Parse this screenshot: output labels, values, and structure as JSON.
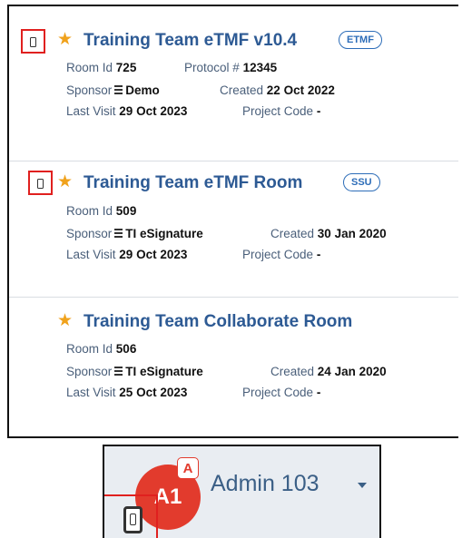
{
  "rooms": [
    {
      "title": "Training Team eTMF v10.4",
      "tag": "ETMF",
      "has_mobile_icon": true,
      "room_id_label": "Room Id",
      "room_id": "725",
      "protocol_label": "Protocol #",
      "protocol": "12345",
      "sponsor_label": "Sponsor",
      "sponsor": "Demo",
      "created_label": "Created",
      "created": "22 Oct 2022",
      "last_visit_label": "Last Visit",
      "last_visit": "29 Oct 2023",
      "project_code_label": "Project Code",
      "project_code": "-"
    },
    {
      "title": "Training Team eTMF Room",
      "tag": "SSU",
      "has_mobile_icon": true,
      "room_id_label": "Room Id",
      "room_id": "509",
      "sponsor_label": "Sponsor",
      "sponsor": "TI eSignature",
      "created_label": "Created",
      "created": "30 Jan 2020",
      "last_visit_label": "Last Visit",
      "last_visit": "29 Oct 2023",
      "project_code_label": "Project Code",
      "project_code": "-"
    },
    {
      "title": "Training Team Collaborate Room",
      "has_mobile_icon": false,
      "room_id_label": "Room Id",
      "room_id": "506",
      "sponsor_label": "Sponsor",
      "sponsor": "TI eSignature",
      "created_label": "Created",
      "created": "24 Jan 2020",
      "last_visit_label": "Last Visit",
      "last_visit": "25 Oct 2023",
      "project_code_label": "Project Code",
      "project_code": "-"
    }
  ],
  "user_menu": {
    "avatar_initials": "A1",
    "admin_badge": "A",
    "name": "Admin 103",
    "dropdown_icon": "caret-down-icon",
    "mobile_icon": "mobile-device-icon"
  },
  "colors": {
    "title": "#2d5a94",
    "star": "#f0a21c",
    "highlight": "#e0201f",
    "avatar": "#e23b2d"
  }
}
